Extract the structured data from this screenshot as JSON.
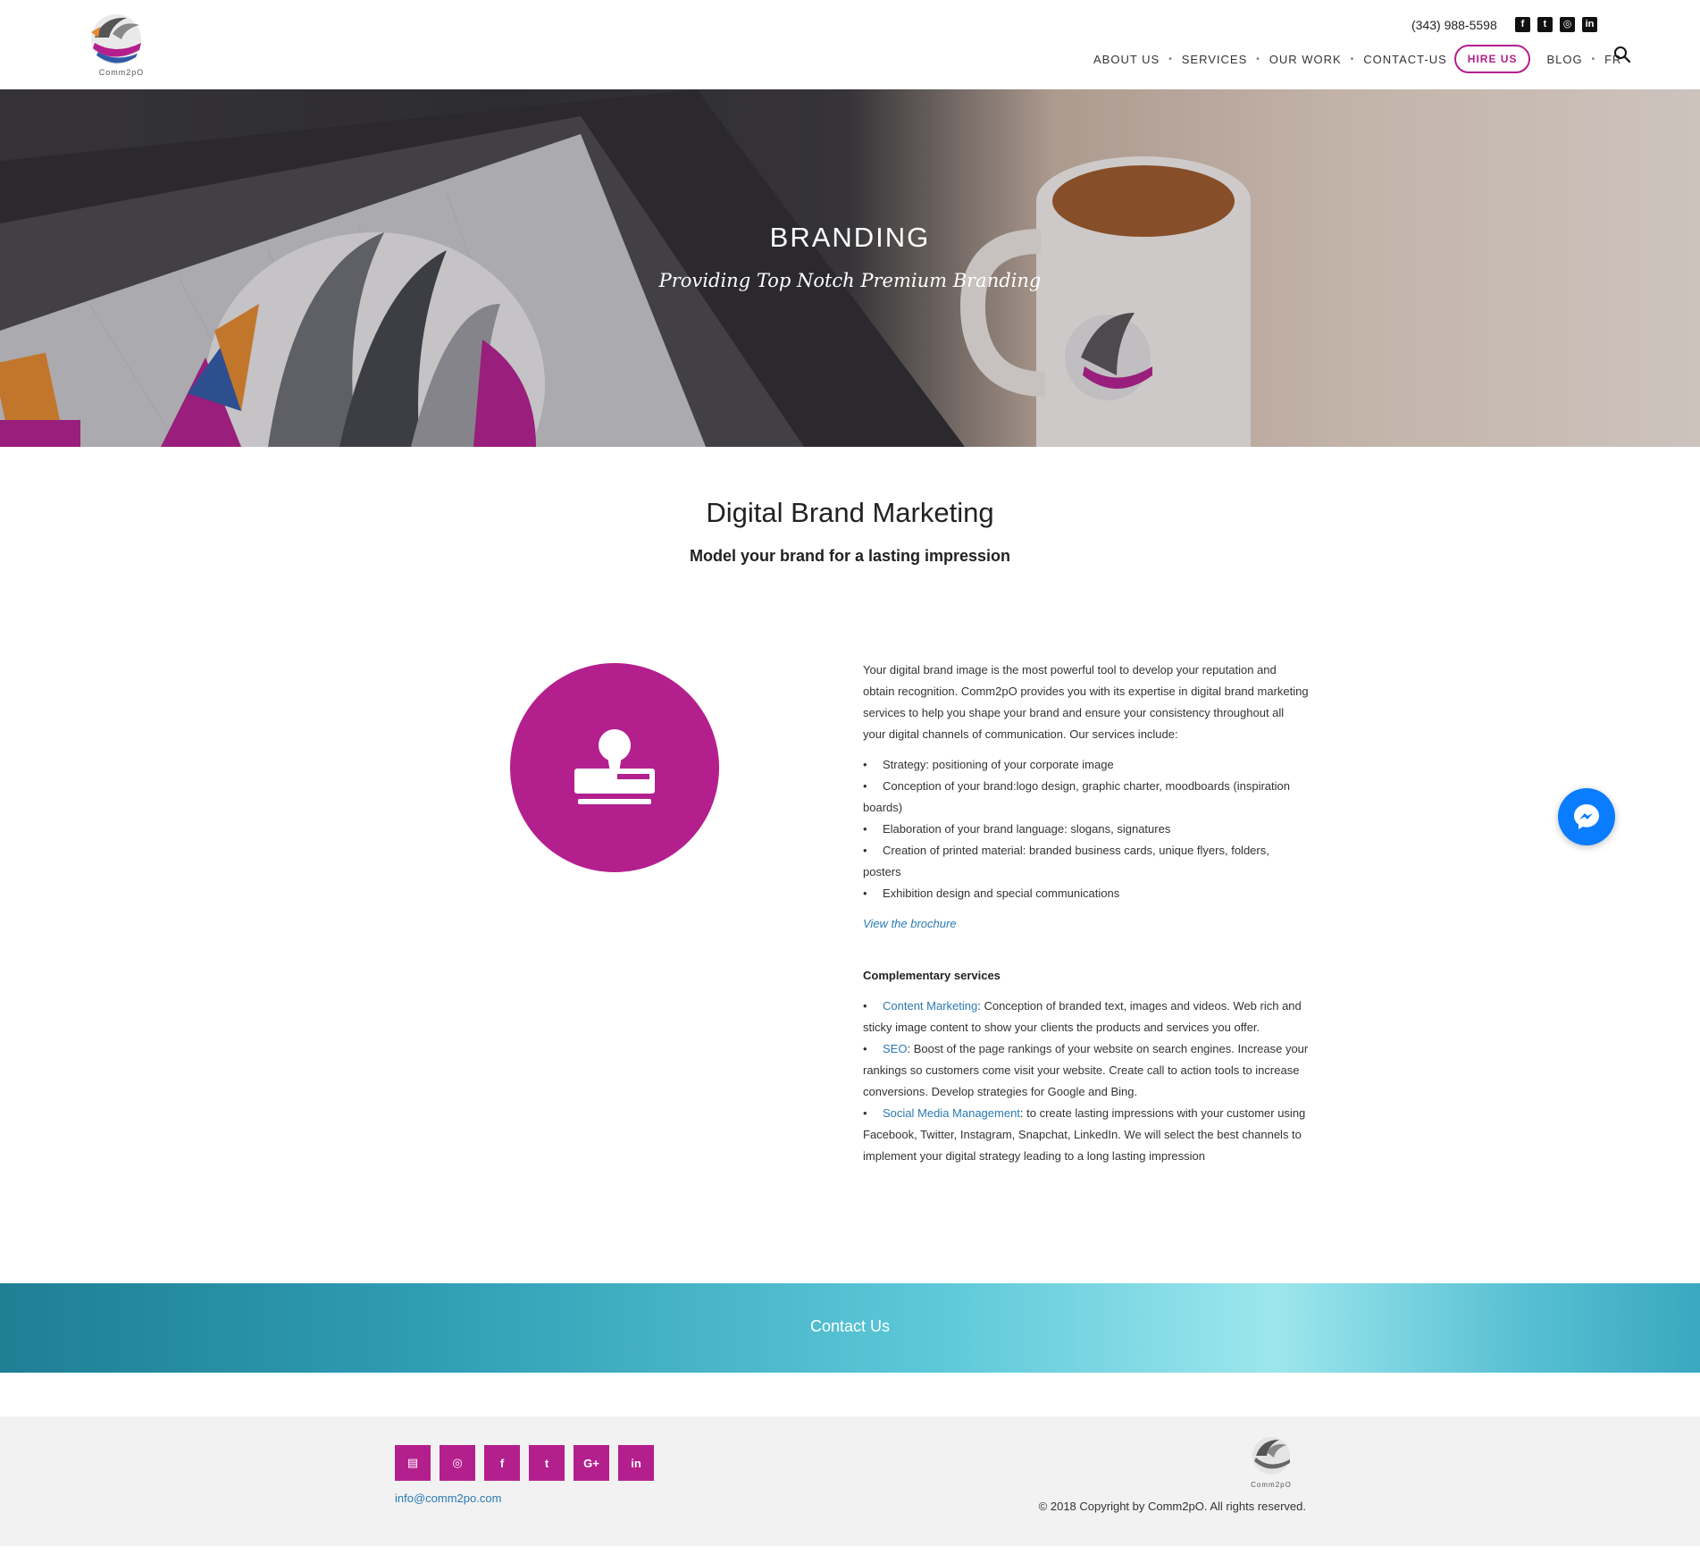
{
  "header": {
    "logo_text": "Comm2pO",
    "phone": "(343) 988-5598",
    "social": [
      {
        "icon": "facebook-icon",
        "glyph": "f"
      },
      {
        "icon": "twitter-icon",
        "glyph": "t"
      },
      {
        "icon": "instagram-icon",
        "glyph": "◎"
      },
      {
        "icon": "linkedin-icon",
        "glyph": "in"
      }
    ],
    "nav": {
      "about": "ABOUT US",
      "services": "SERVICES",
      "our_work": "OUR WORK",
      "contact": "CONTACT-US",
      "hire": "HIRE US",
      "blog": "BLOG",
      "lang": "FR",
      "separator": "•"
    }
  },
  "hero": {
    "title": "BRANDING",
    "subtitle": "Providing Top Notch Premium Branding"
  },
  "main": {
    "title": "Digital Brand Marketing",
    "subtitle": "Model your brand for a lasting impression",
    "intro": "Your digital brand image is the most powerful tool to develop your reputation and obtain recognition. Comm2pO provides you with its expertise in digital brand marketing services to help you shape your brand and ensure your consistency throughout all your digital channels of communication. Our services include:",
    "bullet": "•",
    "services": [
      "Strategy: positioning of your corporate image",
      "Conception of your brand:logo design, graphic charter, moodboards (inspiration boards)",
      "Elaboration of your brand language: slogans, signatures",
      "Creation of printed material: branded business cards, unique flyers, folders, posters",
      "Exhibition design and special communications"
    ],
    "brochure_link": "View the brochure",
    "complementary_title": "Complementary services",
    "complementary": [
      {
        "link": "Content Marketing",
        "text": ": Conception of branded text, images and videos. Web rich and sticky image content to show your clients the products and services you offer."
      },
      {
        "link": "SEO",
        "text": ": Boost of the page rankings of your website on search engines. Increase your rankings so customers come visit your website. Create call to action tools to increase conversions. Develop strategies for Google and Bing."
      },
      {
        "link": "Social Media Management",
        "text": ": to create lasting impressions with your customer using Facebook, Twitter, Instagram, Snapchat, LinkedIn. We will select the best channels to implement your digital strategy leading to a long lasting impression"
      }
    ]
  },
  "contact_banner": {
    "label": "Contact Us"
  },
  "footer": {
    "icons": [
      {
        "icon": "contact-card-icon",
        "glyph": "▤"
      },
      {
        "icon": "instagram-icon",
        "glyph": "◎"
      },
      {
        "icon": "facebook-icon",
        "glyph": "f"
      },
      {
        "icon": "twitter-icon",
        "glyph": "t"
      },
      {
        "icon": "google-plus-icon",
        "glyph": "G+"
      },
      {
        "icon": "linkedin-icon",
        "glyph": "in"
      }
    ],
    "email": "info@comm2po.com",
    "logo_text": "Comm2pO",
    "copyright": "© 2018 Copyright by Comm2pO. All rights reserved."
  },
  "colors": {
    "brand": "#b41f8e",
    "link": "#2a7ab5",
    "messenger": "#0a7cff"
  }
}
